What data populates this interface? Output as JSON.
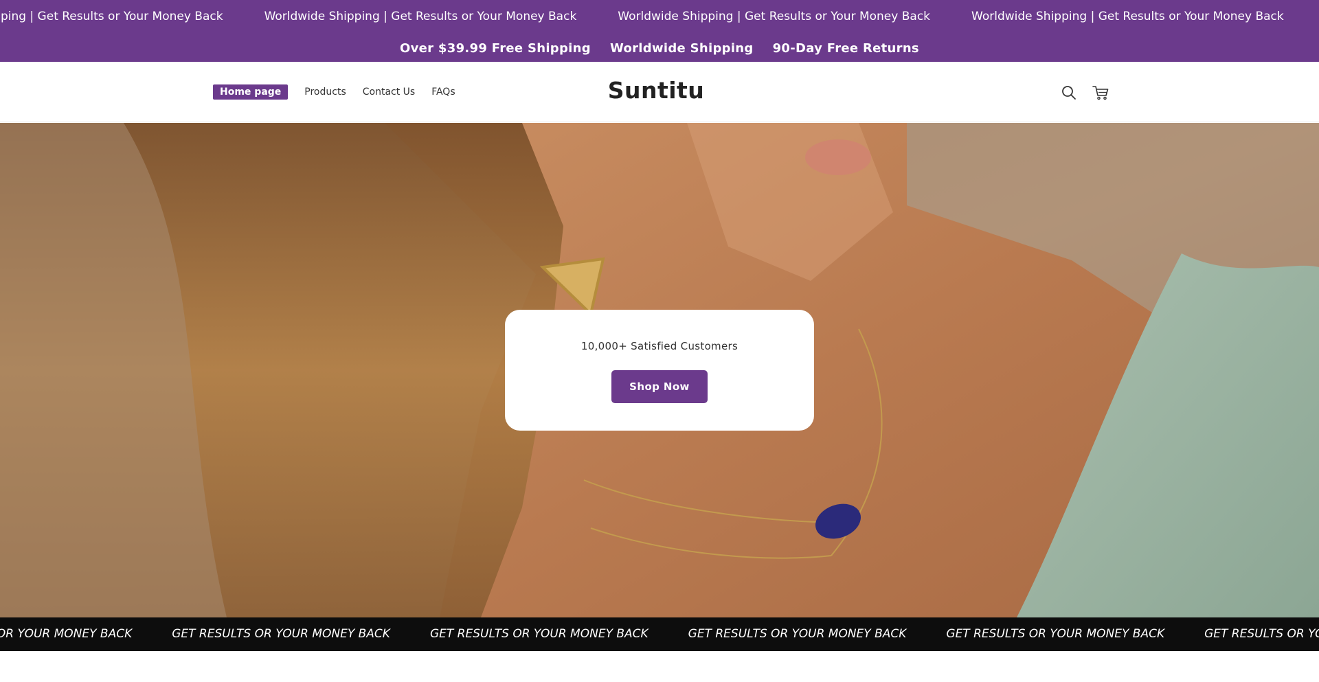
{
  "top_marquee": {
    "items": [
      "e Shipping | Get Results or Your Money Back",
      "Worldwide Shipping | Get Results or Your Money Back",
      "Worldwide Shipping | Get Results or Your Money Back",
      "Worldwide Shipping | Get Results or Your Money Back"
    ]
  },
  "announcement": {
    "items": [
      "Over $39.99 Free Shipping",
      "Worldwide Shipping",
      "90-Day Free Returns"
    ]
  },
  "header": {
    "brand": "Suntitu",
    "nav": [
      {
        "label": "Home page",
        "active": true
      },
      {
        "label": "Products"
      },
      {
        "label": "Contact Us"
      },
      {
        "label": "FAQs"
      }
    ],
    "icons": [
      "search-icon",
      "cart-icon"
    ]
  },
  "hero": {
    "subtitle": "10,000+ Satisfied Customers",
    "cta": "Shop Now"
  },
  "bottom_marquee": {
    "items": [
      "LTS OR YOUR MONEY BACK",
      "GET RESULTS OR YOUR MONEY BACK",
      "GET RESULTS OR YOUR MONEY BACK",
      "GET RESULTS OR YOUR MONEY BACK",
      "GET RESULTS OR YOUR MONEY BACK",
      "GET RESULTS OR YOUR MON"
    ]
  },
  "colors": {
    "brand_purple": "#6b3a8c",
    "marquee_black": "#0d0d0d"
  }
}
